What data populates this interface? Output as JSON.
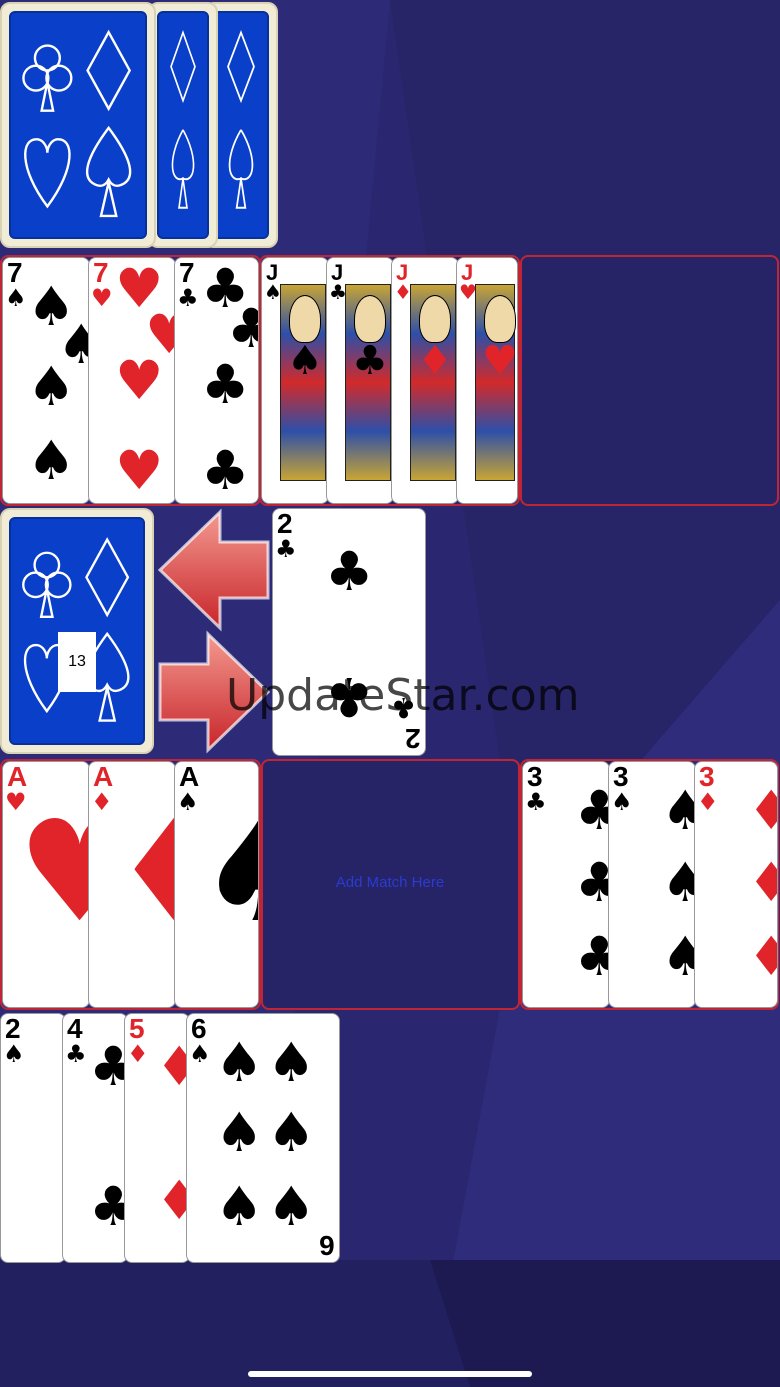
{
  "stock_count": "13",
  "watermark": "UpdateStar.com",
  "empty_slot_label": "Add Match Here",
  "colors": {
    "table": "#2a2770",
    "card_back": "#0a3fc9",
    "pile_border": "#c02535",
    "red_suit": "#e0242a"
  },
  "icons": {
    "left_arrow": "arrow-left-icon",
    "right_arrow": "arrow-right-icon"
  },
  "cards": {
    "sevens": [
      {
        "rank": "7",
        "suit": "♠"
      },
      {
        "rank": "7",
        "suit": "♥"
      },
      {
        "rank": "7",
        "suit": "♣"
      }
    ],
    "jacks": [
      {
        "rank": "J",
        "suit": "♠"
      },
      {
        "rank": "J",
        "suit": "♣"
      },
      {
        "rank": "J",
        "suit": "♦"
      },
      {
        "rank": "J",
        "suit": "♥"
      }
    ],
    "drawn": {
      "rank": "2",
      "suit": "♣"
    },
    "aces": [
      {
        "rank": "A",
        "suit": "♥"
      },
      {
        "rank": "A",
        "suit": "♦"
      },
      {
        "rank": "A",
        "suit": "♠"
      }
    ],
    "threes": [
      {
        "rank": "3",
        "suit": "♣"
      },
      {
        "rank": "3",
        "suit": "♠"
      },
      {
        "rank": "3",
        "suit": "♦"
      }
    ],
    "hand": [
      {
        "rank": "2",
        "suit": "♠"
      },
      {
        "rank": "4",
        "suit": "♣"
      },
      {
        "rank": "5",
        "suit": "♦"
      },
      {
        "rank": "6",
        "suit": "♠"
      }
    ]
  }
}
